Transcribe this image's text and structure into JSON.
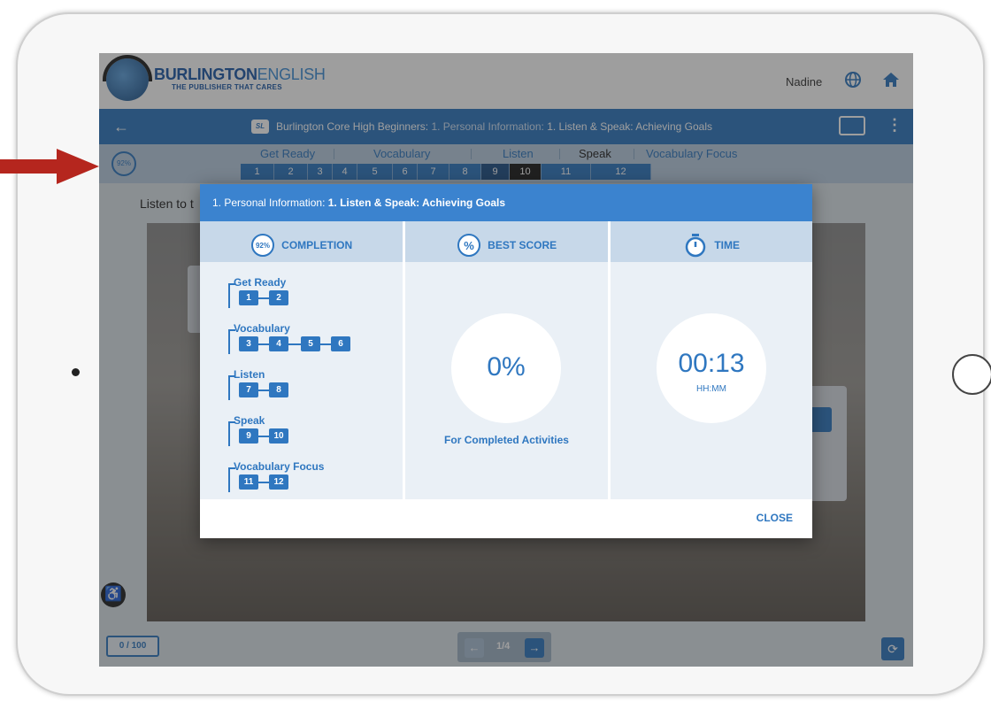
{
  "header": {
    "brand_main": "BURLINGTON",
    "brand_accent": "ENGLISH",
    "tagline": "THE PUBLISHER THAT CARES",
    "user_name": "Nadine"
  },
  "navbar": {
    "course_icon_label": "SL",
    "course_name": "Burlington Core High Beginners:",
    "breadcrumb_unit": "1. Personal Information:",
    "breadcrumb_lesson": "1. Listen & Speak: Achieving Goals"
  },
  "progress": {
    "percent_label": "92%",
    "sections": [
      {
        "name": "Get Ready",
        "steps": [
          "1",
          "2"
        ]
      },
      {
        "name": "Vocabulary",
        "steps": [
          "3",
          "4",
          "5",
          "6"
        ]
      },
      {
        "name": "Listen",
        "steps": [
          "7",
          "8"
        ]
      },
      {
        "name": "Speak",
        "steps": [
          "9",
          "10"
        ]
      },
      {
        "name": "Vocabulary Focus",
        "steps": [
          "11",
          "12"
        ]
      }
    ],
    "current_step": "10"
  },
  "content": {
    "instruction_partial": "Listen to t"
  },
  "footer": {
    "score": "0 / 100",
    "page": "1/4"
  },
  "modal": {
    "title_unit": "1. Personal Information:",
    "title_lesson": "1. Listen & Speak: Achieving Goals",
    "completion": {
      "icon_percent": "92%",
      "label": "COMPLETION"
    },
    "best_score": {
      "icon_label": "%",
      "label": "BEST SCORE",
      "value": "0%",
      "note": "For Completed Activities"
    },
    "time": {
      "label": "TIME",
      "value": "00:13",
      "unit": "HH:MM"
    },
    "close_label": "CLOSE"
  },
  "colors": {
    "primary": "#2f77c0",
    "header_bar": "#3b83cf",
    "arrow_red": "#b5261e"
  }
}
